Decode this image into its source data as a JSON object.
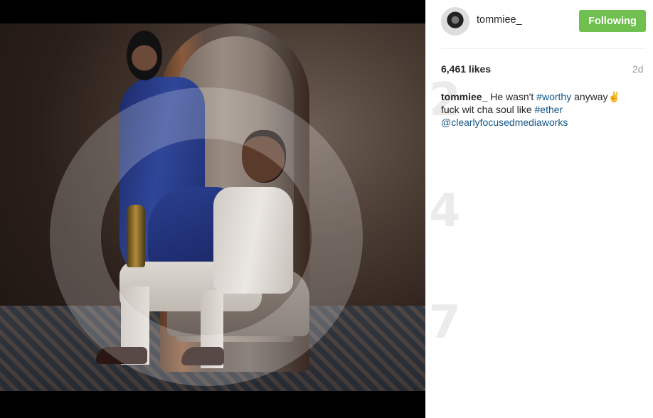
{
  "post": {
    "username": "tommiee_",
    "follow_label": "Following",
    "likes": "6,461 likes",
    "age": "2d",
    "caption": {
      "author": "tommiee_",
      "line1_pre": " He wasn't ",
      "hashtag1": "#worthy",
      "line1_post": " anyway✌",
      "line2_pre": "fuck wit cha soul like ",
      "hashtag2": "#ether",
      "mention": "@clearlyfocusedmediaworks"
    }
  },
  "watermark": {
    "digits": [
      "2",
      "4",
      "7"
    ]
  },
  "colors": {
    "follow_button": "#70c050",
    "link": "#125688",
    "text": "#262626",
    "muted": "#999999"
  },
  "icons": [
    "avatar-image",
    "victory-hand-emoji"
  ]
}
